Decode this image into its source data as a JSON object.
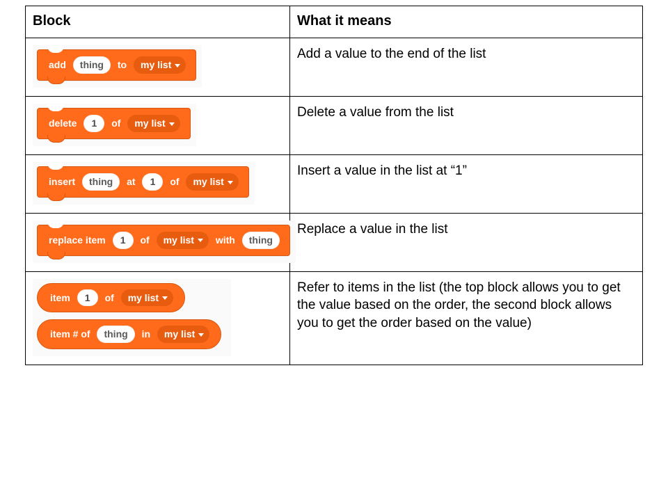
{
  "headers": {
    "block": "Block",
    "meaning": "What it means"
  },
  "words": {
    "add": "add",
    "to": "to",
    "delete": "delete",
    "of": "of",
    "insert": "insert",
    "at": "at",
    "replace_item": "replace item",
    "with": "with",
    "item": "item",
    "item_hash_of": "item # of",
    "in": "in"
  },
  "slots": {
    "thing": "thing",
    "one": "1",
    "mylist": "my list"
  },
  "rows": [
    {
      "desc": "Add a value to the end of the list"
    },
    {
      "desc": "Delete a value from the list"
    },
    {
      "desc": "Insert a value in the list at “1”"
    },
    {
      "desc": "Replace a value in the list"
    },
    {
      "desc": "Refer to items in the list (the top block allows you to get the value based on the order, the second block allows you to get the order based on the value)"
    }
  ]
}
